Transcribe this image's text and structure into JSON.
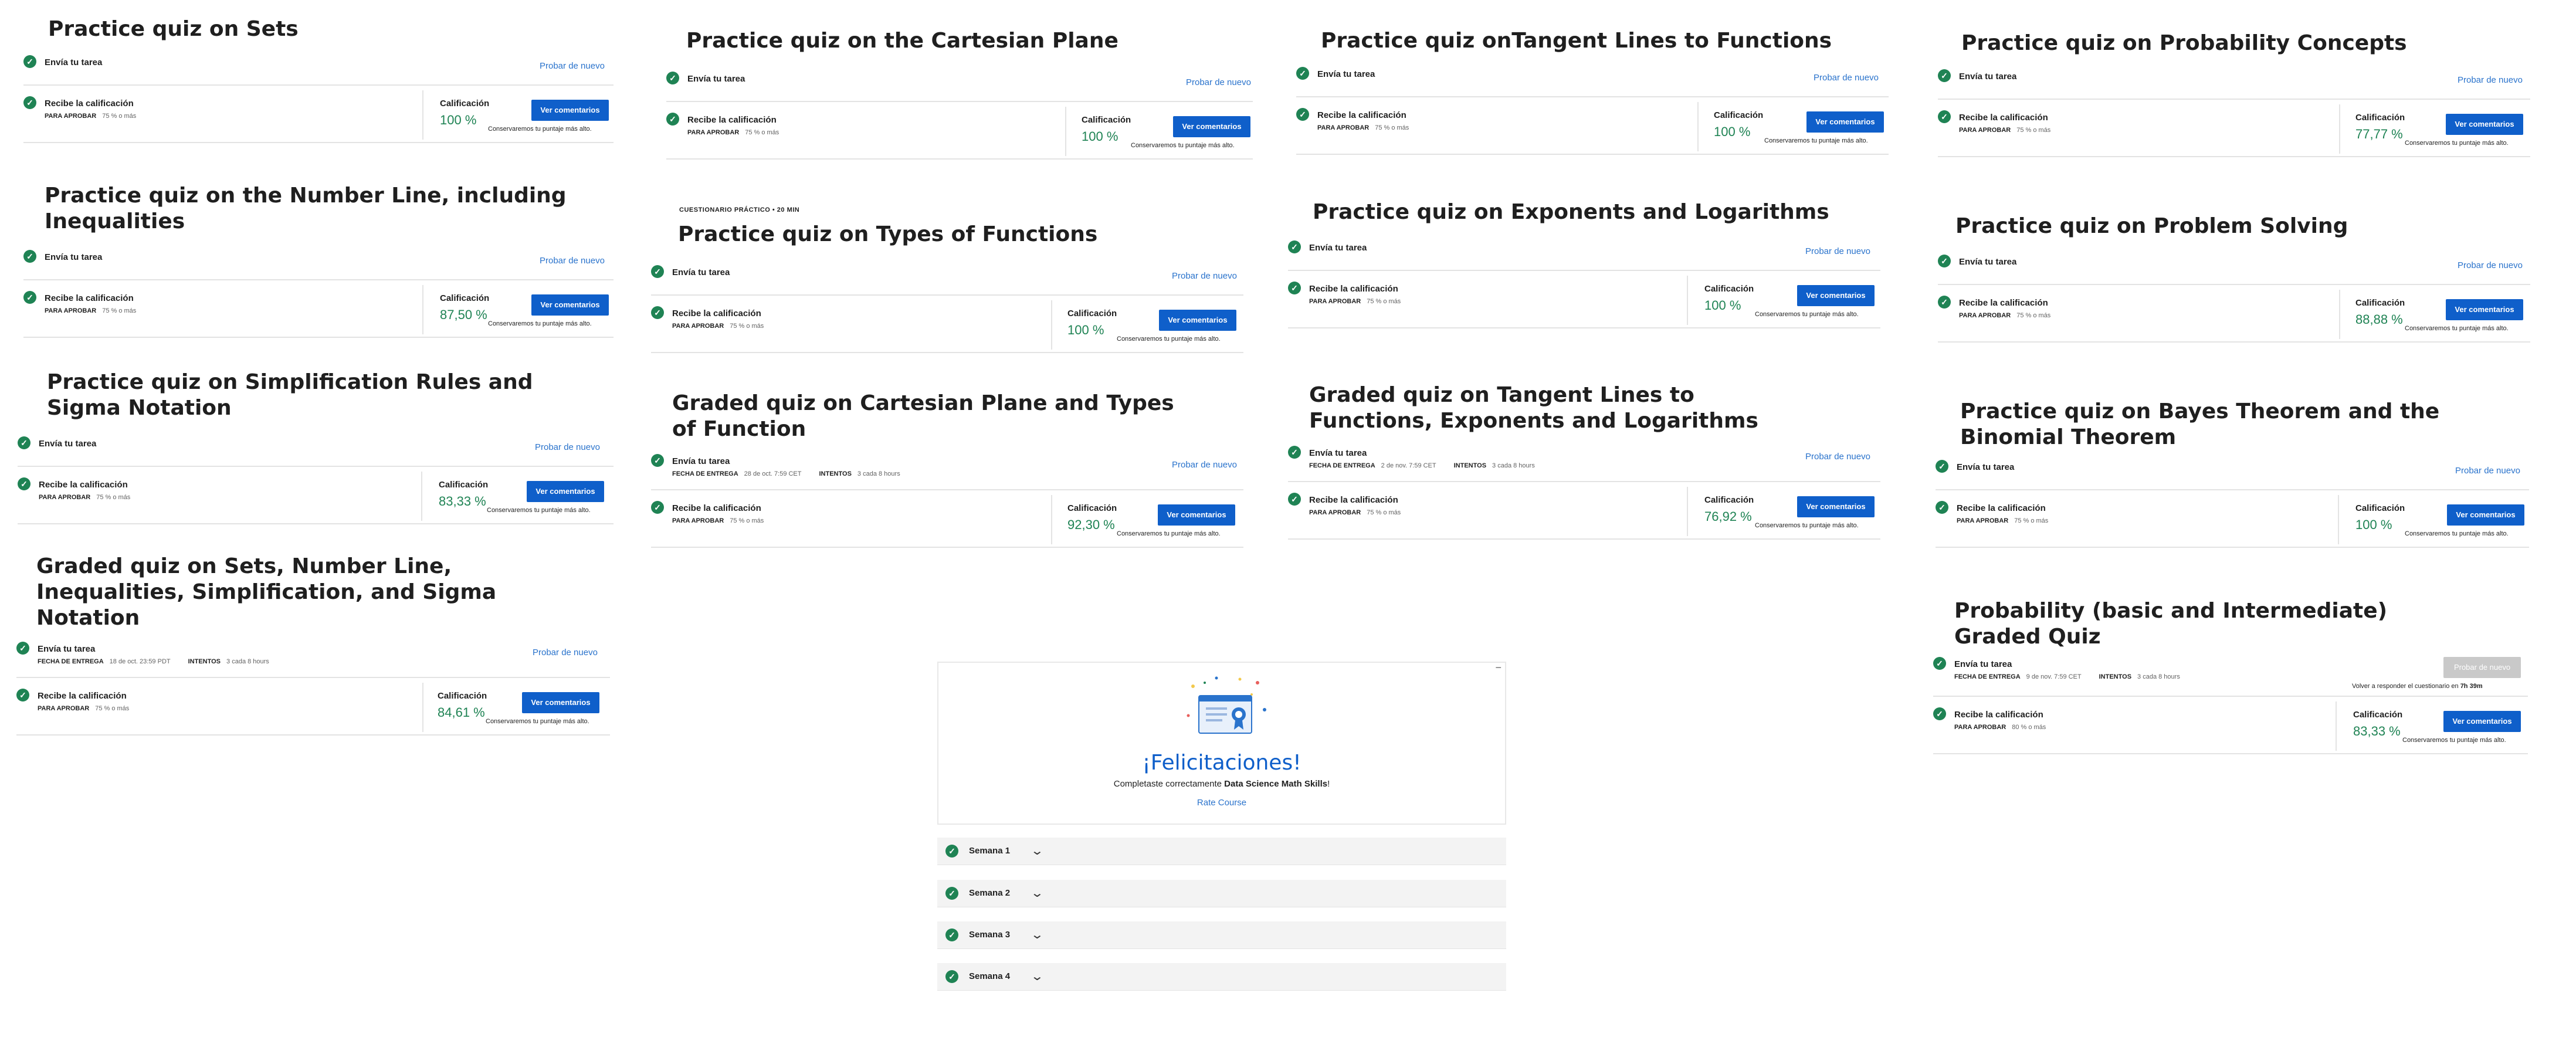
{
  "labels": {
    "submit": "Envía tu tarea",
    "receive": "Recibe la calificación",
    "pass_label": "PARA APROBAR",
    "grade_label": "Calificación",
    "retry": "Probar de nuevo",
    "view_feedback": "Ver comentarios",
    "keep_highest": "Conservaremos tu puntaje más alto.",
    "due_label": "FECHA DE ENTREGA",
    "attempts_label": "INTENTOS"
  },
  "quizzes": [
    {
      "title": "Practice quiz on Sets",
      "pass": "75 % o más",
      "grade": "100 %"
    },
    {
      "title": "Practice quiz on the Number Line, including Inequalities",
      "pass": "75 % o más",
      "grade": "87,50 %"
    },
    {
      "title": "Practice quiz on Simplification Rules and Sigma Notation",
      "pass": "75 % o más",
      "grade": "83,33 %"
    },
    {
      "title": "Graded quiz on Sets, Number Line, Inequalities, Simplification, and Sigma Notation",
      "due": "18 de oct. 23:59 PDT",
      "attempts": "3 cada 8 hours",
      "pass": "75 % o más",
      "grade": "84,61 %"
    },
    {
      "title": "Practice quiz on the Cartesian Plane",
      "pass": "75 % o más",
      "grade": "100 %"
    },
    {
      "tag": "CUESTIONARIO PRÁCTICO • 20 MIN",
      "title": "Practice quiz on Types of Functions",
      "pass": "75 % o más",
      "grade": "100 %"
    },
    {
      "title": "Graded quiz on Cartesian Plane and Types of Function",
      "due": "28 de oct. 7:59 CET",
      "attempts": "3 cada 8 hours",
      "pass": "75 % o más",
      "grade": "92,30 %"
    },
    {
      "title": "Practice quiz onTangent Lines to Functions",
      "pass": "75 % o más",
      "grade": "100 %"
    },
    {
      "title": "Practice quiz on Exponents and Logarithms",
      "pass": "75 % o más",
      "grade": "100 %"
    },
    {
      "title": "Graded quiz on Tangent Lines to Functions, Exponents and Logarithms",
      "due": "2 de nov. 7:59 CET",
      "attempts": "3 cada 8 hours",
      "pass": "75 % o más",
      "grade": "76,92 %"
    },
    {
      "title": "Practice quiz on Probability Concepts",
      "pass": "75 % o más",
      "grade": "77,77 %"
    },
    {
      "title": "Practice quiz on Problem Solving",
      "pass": "75 % o más",
      "grade": "88,88 %"
    },
    {
      "title": "Practice quiz on Bayes Theorem and the Binomial Theorem",
      "pass": "75 % o más",
      "grade": "100 %"
    },
    {
      "title": "Probability (basic and Intermediate) Graded Quiz",
      "due": "9 de nov. 7:59 CET",
      "attempts": "3 cada 8 hours",
      "pass": "80 % o más",
      "grade": "83,33 %",
      "retry_note": "Volver a responder el cuestionario en",
      "retry_time": "7h 39m"
    }
  ],
  "congrats": {
    "title": "¡Felicitaciones!",
    "sub_prefix": "Completaste correctamente",
    "course": "Data Science Math Skills",
    "sub_suffix": "!",
    "rate": "Rate Course",
    "close": "−"
  },
  "weeks": [
    "Semana 1",
    "Semana 2",
    "Semana 3",
    "Semana 4"
  ],
  "colors": {
    "success": "#1f8354",
    "primary": "#0f5fca",
    "link": "#2a73cc"
  }
}
